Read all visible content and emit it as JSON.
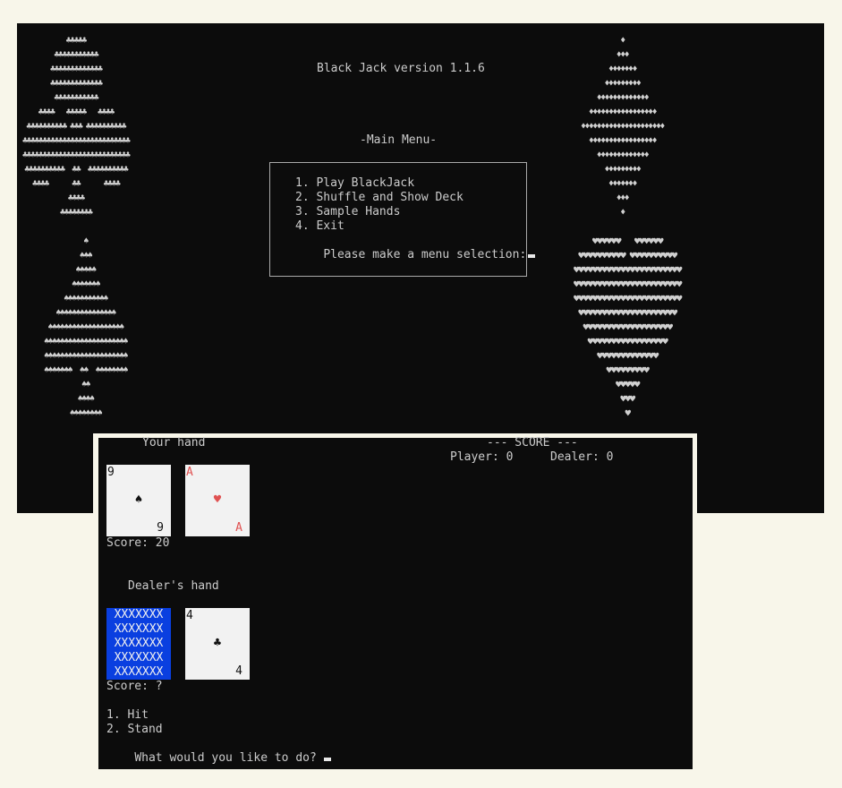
{
  "menu_console": {
    "title": "Black Jack version 1.1.6",
    "menu_heading": "-Main Menu-",
    "items": [
      "1. Play BlackJack",
      "2. Shuffle and Show Deck",
      "3. Sample Hands",
      "4. Exit"
    ],
    "prompt": "Please make a menu selection:",
    "art": {
      "club": "♣♣♣♣♣\n♣♣♣♣♣♣♣♣♣♣♣\n♣♣♣♣♣♣♣♣♣♣♣♣♣\n♣♣♣♣♣♣♣♣♣♣♣♣♣\n♣♣♣♣♣♣♣♣♣♣♣\n♣♣♣♣   ♣♣♣♣♣   ♣♣♣♣\n♣♣♣♣♣♣♣♣♣♣ ♣♣♣ ♣♣♣♣♣♣♣♣♣♣\n♣♣♣♣♣♣♣♣♣♣♣♣♣♣♣♣♣♣♣♣♣♣♣♣♣♣♣\n♣♣♣♣♣♣♣♣♣♣♣♣♣♣♣♣♣♣♣♣♣♣♣♣♣♣♣\n♣♣♣♣♣♣♣♣♣♣  ♣♣  ♣♣♣♣♣♣♣♣♣♣\n♣♣♣♣      ♣♣      ♣♣♣♣\n♣♣♣♣\n♣♣♣♣♣♣♣♣",
      "spade": "♠\n♠♠♠\n♠♠♠♠♠\n♠♠♠♠♠♠♠\n♠♠♠♠♠♠♠♠♠♠♠\n♠♠♠♠♠♠♠♠♠♠♠♠♠♠♠\n♠♠♠♠♠♠♠♠♠♠♠♠♠♠♠♠♠♠♠\n♠♠♠♠♠♠♠♠♠♠♠♠♠♠♠♠♠♠♠♠♠\n♠♠♠♠♠♠♠♠♠♠♠♠♠♠♠♠♠♠♠♠♠\n♠♠♠♠♠♠♠  ♠♠  ♠♠♠♠♠♠♠♠\n♠♠\n♠♠♠♠\n♠♠♠♠♠♠♠♠",
      "diamond": "♦\n♦♦♦\n♦♦♦♦♦♦♦\n♦♦♦♦♦♦♦♦♦\n♦♦♦♦♦♦♦♦♦♦♦♦♦\n♦♦♦♦♦♦♦♦♦♦♦♦♦♦♦♦♦\n♦♦♦♦♦♦♦♦♦♦♦♦♦♦♦♦♦♦♦♦♦\n♦♦♦♦♦♦♦♦♦♦♦♦♦♦♦♦♦\n♦♦♦♦♦♦♦♦♦♦♦♦♦\n♦♦♦♦♦♦♦♦♦\n♦♦♦♦♦♦♦\n♦♦♦\n♦",
      "heart": "♥♥♥♥♥♥   ♥♥♥♥♥♥\n♥♥♥♥♥♥♥♥♥♥ ♥♥♥♥♥♥♥♥♥♥\n♥♥♥♥♥♥♥♥♥♥♥♥♥♥♥♥♥♥♥♥♥♥♥\n♥♥♥♥♥♥♥♥♥♥♥♥♥♥♥♥♥♥♥♥♥♥♥\n♥♥♥♥♥♥♥♥♥♥♥♥♥♥♥♥♥♥♥♥♥♥♥\n♥♥♥♥♥♥♥♥♥♥♥♥♥♥♥♥♥♥♥♥♥\n♥♥♥♥♥♥♥♥♥♥♥♥♥♥♥♥♥♥♥\n♥♥♥♥♥♥♥♥♥♥♥♥♥♥♥♥♥\n♥♥♥♥♥♥♥♥♥♥♥♥♥\n♥♥♥♥♥♥♥♥♥\n♥♥♥♥♥\n♥♥♥\n♥"
    }
  },
  "game_console": {
    "your_hand_label": "Your hand",
    "score_heading": "--- SCORE ---",
    "player_score": "Player: 0",
    "dealer_score": "Dealer: 0",
    "player_cards": [
      {
        "rank": "9",
        "suit": "♠",
        "color": "#111111"
      },
      {
        "rank": "A",
        "suit": "♥",
        "color": "#e05252"
      }
    ],
    "player_total": "Score: 20",
    "dealer_hand_label": "Dealer's hand",
    "hidden_card_rows": [
      "XXXXXXX",
      "XXXXXXX",
      "XXXXXXX",
      "XXXXXXX",
      "XXXXXXX"
    ],
    "dealer_cards": [
      {
        "rank": "4",
        "suit": "♣",
        "color": "#111111"
      }
    ],
    "dealer_total": "Score: ?",
    "options": [
      "1. Hit",
      "2. Stand"
    ],
    "prompt": "What would you like to do?"
  },
  "colors": {
    "console_bg": "#0c0c0c",
    "console_text": "#cccccc",
    "page_bg": "#f8f6ea",
    "card_face": "#f2f2f2",
    "card_back": "#0a3fe0",
    "red_suit": "#e05252"
  }
}
